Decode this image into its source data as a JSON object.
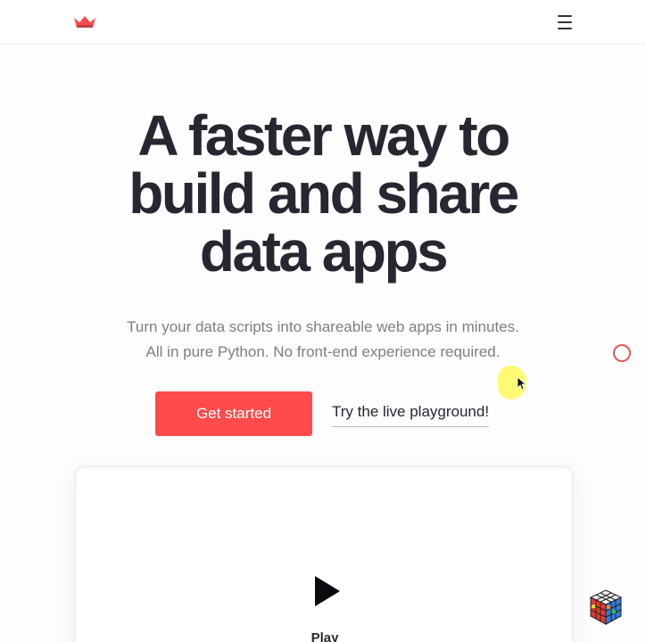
{
  "header": {
    "logo_icon": "streamlit-crown-logo",
    "menu_icon": "hamburger-menu-icon"
  },
  "hero": {
    "title_lines": [
      "A faster way to",
      "build and share",
      "data apps"
    ],
    "subtitle_lines": [
      "Turn your data scripts into shareable web apps in minutes.",
      "All in pure Python. No front-end experience required."
    ],
    "primary_cta": "Get started",
    "secondary_cta": "Try the live playground!"
  },
  "video": {
    "play_icon": "play-icon",
    "play_label": "Play"
  },
  "widget": {
    "icon": "rubiks-cube-icon"
  },
  "colors": {
    "brand": "#ff4b4b",
    "text": "#262730",
    "muted": "#7c7e86",
    "cursor_highlight": "#fff95a"
  }
}
